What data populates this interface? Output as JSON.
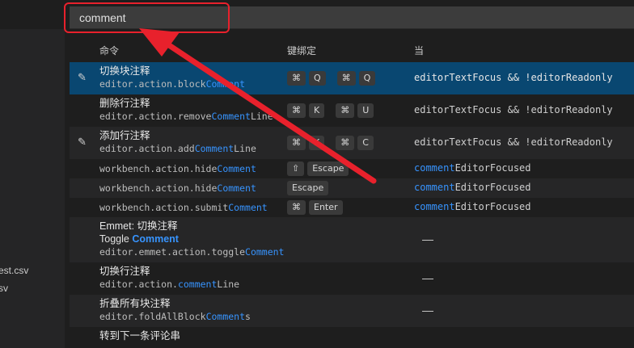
{
  "explorer": {
    "files": [
      "est.csv",
      "sv"
    ]
  },
  "search": {
    "value": "comment"
  },
  "table": {
    "headers": {
      "command": "命令",
      "keybinding": "键绑定",
      "when": "当"
    }
  },
  "rows": [
    {
      "title": "切换块注释",
      "id_pre": "editor.action.block",
      "id_hl": "Comment",
      "id_post": "",
      "keys": [
        "⌘",
        "Q",
        "⌘",
        "Q"
      ],
      "when_pre": "editorTextFocus && !editorReadonly",
      "when_hl": "",
      "when_post": ""
    },
    {
      "title": "删除行注释",
      "id_pre": "editor.action.remove",
      "id_hl": "Comment",
      "id_post": "Line",
      "keys": [
        "⌘",
        "K",
        "⌘",
        "U"
      ],
      "when_pre": "editorTextFocus && !editorReadonly",
      "when_hl": "",
      "when_post": ""
    },
    {
      "title": "添加行注释",
      "id_pre": "editor.action.add",
      "id_hl": "Comment",
      "id_post": "Line",
      "keys": [
        "⌘",
        "K",
        "⌘",
        "C"
      ],
      "when_pre": "editorTextFocus && !editorReadonly",
      "when_hl": "",
      "when_post": ""
    },
    {
      "id_pre": "workbench.action.hide",
      "id_hl": "Comment",
      "id_post": "",
      "keys": [
        "⇧",
        "Escape"
      ],
      "when_pre": "",
      "when_hl": "comment",
      "when_post": "EditorFocused"
    },
    {
      "id_pre": "workbench.action.hide",
      "id_hl": "Comment",
      "id_post": "",
      "keys": [
        "Escape"
      ],
      "when_pre": "",
      "when_hl": "comment",
      "when_post": "EditorFocused"
    },
    {
      "id_pre": "workbench.action.submit",
      "id_hl": "Comment",
      "id_post": "",
      "keys": [
        "⌘",
        "Enter"
      ],
      "when_pre": "",
      "when_hl": "comment",
      "when_post": "EditorFocused"
    },
    {
      "title": "Emmet: 切换注释",
      "subtitle_pre": "Toggle ",
      "subtitle_hl": "Comment",
      "id_pre": "editor.emmet.action.toggle",
      "id_hl": "Comment",
      "id_post": "",
      "dash": "—"
    },
    {
      "title": "切换行注释",
      "id_pre": "editor.action.",
      "id_hl": "comment",
      "id_post": "Line",
      "dash": "—"
    },
    {
      "title": "折叠所有块注释",
      "id_pre": "editor.foldAllBlock",
      "id_hl": "Comment",
      "id_post": "s",
      "dash": "—"
    },
    {
      "title": "转到下一条评论串",
      "dash": ""
    }
  ],
  "colors": {
    "accent": "#3794ff",
    "selected_row": "#094771",
    "annotation_red": "#e8212c"
  }
}
